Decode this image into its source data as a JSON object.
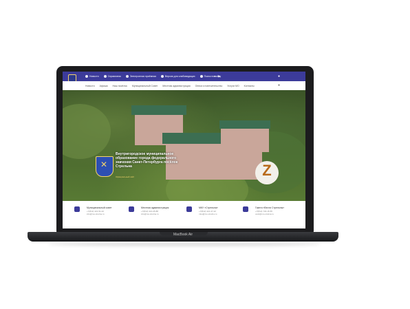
{
  "device": {
    "label": "MacBook Air"
  },
  "topbar": {
    "color": "#3c3b9a",
    "items": [
      "Новости",
      "Справочник",
      "Электронная приёмная",
      "Версия для слабовидящих",
      "Поиск по сайту"
    ],
    "icons": [
      "home-icon",
      "book-icon",
      "mail-icon",
      "eye-icon",
      "search-icon"
    ],
    "social": [
      "vk-icon",
      "youtube-icon"
    ]
  },
  "nav": {
    "items": [
      "Новости",
      "Афиша",
      "Наш посёлок",
      "Муниципальный Совет",
      "Местная администрация",
      "Опеки и попечительство",
      "Услуги МО",
      "Контакты"
    ]
  },
  "hero": {
    "title": "Внутригородское муниципальное образование города федерального значения Санкт-Петербурга посёлок Стрельна",
    "subtitle": "Официальный сайт",
    "badge_caption": "Z"
  },
  "contacts": [
    {
      "title": "Муниципальный совет",
      "phone": "+7(812) 421-51-02",
      "email": "info@mo-strelna.ru",
      "icon": "people-icon"
    },
    {
      "title": "Местная администрация",
      "phone": "+7(812) 421-05-88",
      "email": "info@mo-strelna.ru",
      "icon": "building-icon"
    },
    {
      "title": "МКУ «Стрельна»",
      "phone": "+7(812) 421-47-22",
      "email": "mku@mo-strelna.ru",
      "icon": "car-icon"
    },
    {
      "title": "Газета «Вести Стрельны»",
      "phone": "+7(812) 746-15-55",
      "email": "vesti@mo-strelna.ru",
      "icon": "newspaper-icon"
    }
  ]
}
